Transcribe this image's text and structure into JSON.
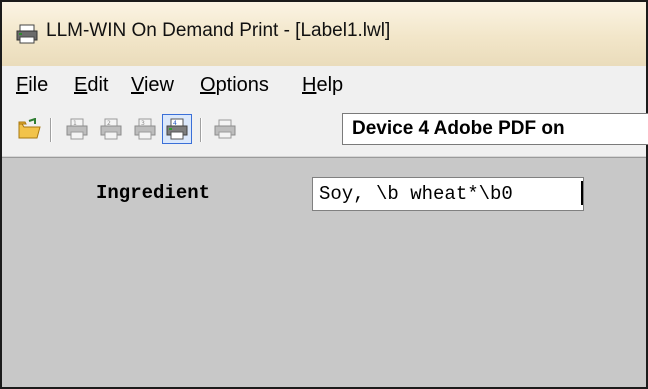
{
  "window": {
    "title": "LLM-WIN On Demand Print - [Label1.lwl]",
    "app_icon": "printer-app-icon"
  },
  "menubar": {
    "items": [
      {
        "accel": "F",
        "rest": "ile"
      },
      {
        "accel": "E",
        "rest": "dit"
      },
      {
        "accel": "V",
        "rest": "iew"
      },
      {
        "accel": "O",
        "rest": "ptions"
      },
      {
        "accel": "H",
        "rest": "elp"
      }
    ]
  },
  "toolbar": {
    "icons": [
      "open-folder-icon",
      "print-1-icon",
      "print-2-icon",
      "print-3-icon",
      "print-active-icon",
      "printer-icon"
    ],
    "active_icon": "print-active-icon",
    "device_selected": "Device 4 Adobe PDF on"
  },
  "form": {
    "field_label": "Ingredient",
    "field_value": "Soy, \\b wheat*\\b0"
  },
  "colors": {
    "titlebar": "#f2e6c9",
    "workspace": "#c8c8c8",
    "active_button_border": "#3a6fd8"
  }
}
